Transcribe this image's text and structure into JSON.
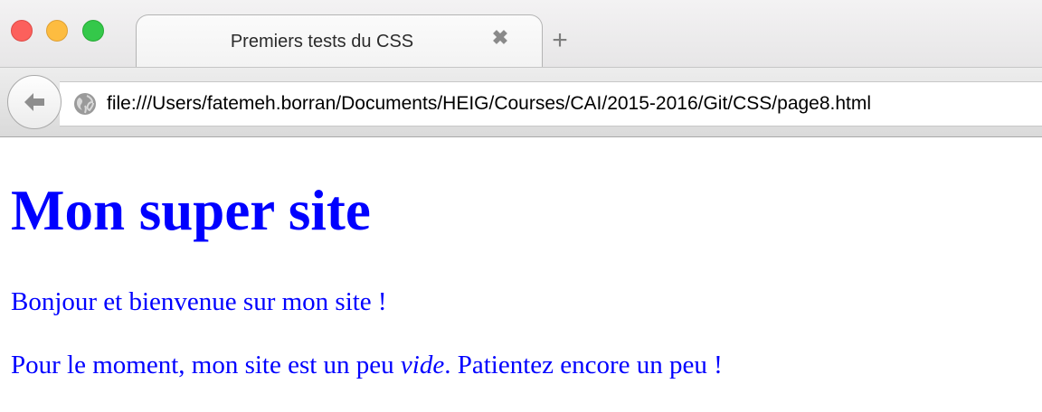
{
  "browser": {
    "tab": {
      "title": "Premiers tests du CSS",
      "close_glyph": "✖"
    },
    "new_tab_glyph": "+",
    "address": {
      "url": "file:///Users/fatemeh.borran/Documents/HEIG/Courses/CAI/2015-2016/Git/CSS/page8.html"
    },
    "icons": {
      "close_window": "close-window-icon",
      "minimize_window": "minimize-window-icon",
      "maximize_window": "maximize-window-icon",
      "back": "arrow-left-icon",
      "site": "globe-icon"
    },
    "colors": {
      "traffic_close": "#fc605c",
      "traffic_minimize": "#fdbc40",
      "traffic_maximize": "#34c84a",
      "page_text": "#0000ff"
    }
  },
  "page": {
    "heading": "Mon super site",
    "paragraph1": "Bonjour et bienvenue sur mon site !",
    "paragraph2": {
      "before": "Pour le moment, mon site est un peu ",
      "emphasis": "vide",
      "after": ". Patientez encore un peu !"
    }
  }
}
